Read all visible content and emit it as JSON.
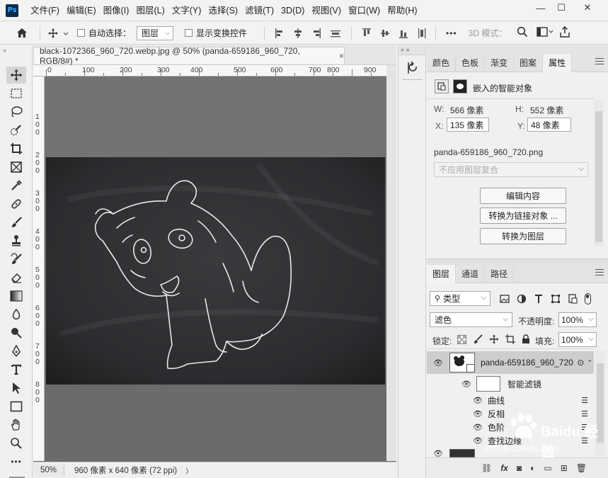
{
  "app": {
    "logo": "Ps"
  },
  "menu": [
    "文件(F)",
    "编辑(E)",
    "图像(I)",
    "图层(L)",
    "文字(Y)",
    "选择(S)",
    "滤镜(T)",
    "3D(D)",
    "视图(V)",
    "窗口(W)",
    "帮助(H)"
  ],
  "window_controls": {
    "minimize": "—",
    "maximize": "☐",
    "close": "✕"
  },
  "options": {
    "auto_select_label": "自动选择：",
    "auto_select_value": "图层",
    "show_transform_label": "显示变换控件",
    "mode_3d_label": "3D 模式：",
    "more": "•••"
  },
  "document": {
    "tab_title": "black-1072366_960_720.webp.jpg @ 50% (panda-659186_960_720, RGB/8#) *",
    "tab_close": "×",
    "ruler_h": [
      "0",
      "100",
      "200",
      "300",
      "400",
      "500",
      "600",
      "700",
      "800",
      "900"
    ],
    "ruler_v": [
      "1 0 0",
      "2 0 0",
      "3 0 0",
      "4 0 0",
      "5 0 0",
      "6 0 0",
      "7 0 0",
      "8 0 0"
    ],
    "status_zoom": "50%",
    "status_info": "960 像素 x 640 像素 (72 ppi)",
    "status_arrow": "〉"
  },
  "panel_top": {
    "tabs": [
      "颜色",
      "色板",
      "渐变",
      "图案",
      "属性"
    ],
    "active_tab": "属性",
    "title": "嵌入的智能对象",
    "w_label": "W:",
    "w_value": "566 像素",
    "h_label": "H:",
    "h_value": "552 像素",
    "x_label": "X:",
    "x_value": "135 像素",
    "y_label": "Y:",
    "y_value": "48 像素",
    "filename": "panda-659186_960_720.png",
    "comp_placeholder": "不应用图层复合",
    "btn_edit": "编辑内容",
    "btn_convert_linked": "转换为链接对象 ...",
    "btn_convert_layers": "转换为图层"
  },
  "panel_layers": {
    "tabs": [
      "图层",
      "通道",
      "路径"
    ],
    "active_tab": "图层",
    "filter_type": "类型",
    "blend_mode": "滤色",
    "opacity_label": "不透明度:",
    "opacity_value": "100%",
    "lock_label": "锁定:",
    "fill_label": "填充:",
    "fill_value": "100%",
    "layers": [
      {
        "name": "panda-659186_960_720"
      },
      {
        "name": "智能滤镜"
      },
      {
        "name": "曲线"
      },
      {
        "name": "反相"
      },
      {
        "name": "色阶"
      },
      {
        "name": "查找边缘"
      }
    ]
  },
  "watermark": {
    "brand": "Baidu 经验",
    "url": "jingyan.baidu.com"
  },
  "colors": {
    "canvas": "#6b6b6b",
    "chalkboard": "#2e2e30",
    "accent": "#31a8ff"
  }
}
